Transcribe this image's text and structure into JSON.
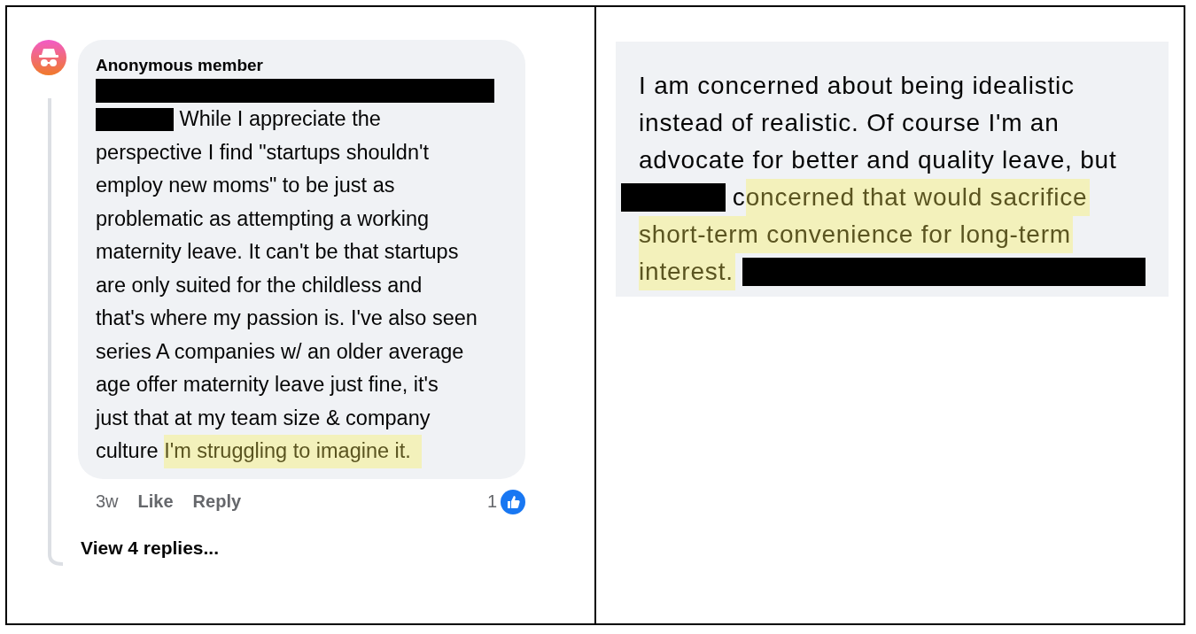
{
  "left": {
    "author": "Anonymous member",
    "lines": [
      [
        {
          "kind": "redaction"
        }
      ],
      [
        {
          "kind": "redaction"
        },
        {
          "kind": "plain",
          "text": "While I appreciate the"
        }
      ],
      [
        {
          "kind": "plain",
          "text": "perspective I find \"startups shouldn't"
        }
      ],
      [
        {
          "kind": "plain",
          "text": "employ new moms\" to be just as"
        }
      ],
      [
        {
          "kind": "plain",
          "text": "problematic as attempting a working"
        }
      ],
      [
        {
          "kind": "plain",
          "text": "maternity leave. It can't be that startups"
        }
      ],
      [
        {
          "kind": "plain",
          "text": "are only suited for the childless and"
        }
      ],
      [
        {
          "kind": "plain",
          "text": "that's where my passion is. I've also seen"
        }
      ],
      [
        {
          "kind": "plain",
          "text": "series A companies w/ an older average"
        }
      ],
      [
        {
          "kind": "plain",
          "text": "age offer maternity leave just fine, it's"
        }
      ],
      [
        {
          "kind": "plain",
          "text": "just that at my team size & company"
        }
      ],
      [
        {
          "kind": "plain",
          "text": "culture"
        },
        {
          "kind": "highlight",
          "text": "I'm struggling to imagine it."
        }
      ]
    ],
    "age": "3w",
    "like": "Like",
    "reply": "Reply",
    "reaction_count": "1",
    "view_replies": "View 4 replies..."
  },
  "right": {
    "lines": [
      [
        {
          "kind": "plain",
          "text": "I am concerned about being idealistic"
        }
      ],
      [
        {
          "kind": "plain",
          "text": "instead of realistic. Of course I'm an"
        }
      ],
      [
        {
          "kind": "plain",
          "text": "advocate for better and quality leave, but"
        }
      ],
      [
        {
          "kind": "redaction"
        },
        {
          "kind": "plain",
          "text": "c"
        },
        {
          "kind": "highlight",
          "text": "oncerned that would sacrifice"
        }
      ],
      [
        {
          "kind": "highlight",
          "text": "short-term convenience for long-term"
        }
      ],
      [
        {
          "kind": "highlight",
          "text": "interest."
        },
        {
          "kind": "redaction"
        }
      ]
    ]
  }
}
